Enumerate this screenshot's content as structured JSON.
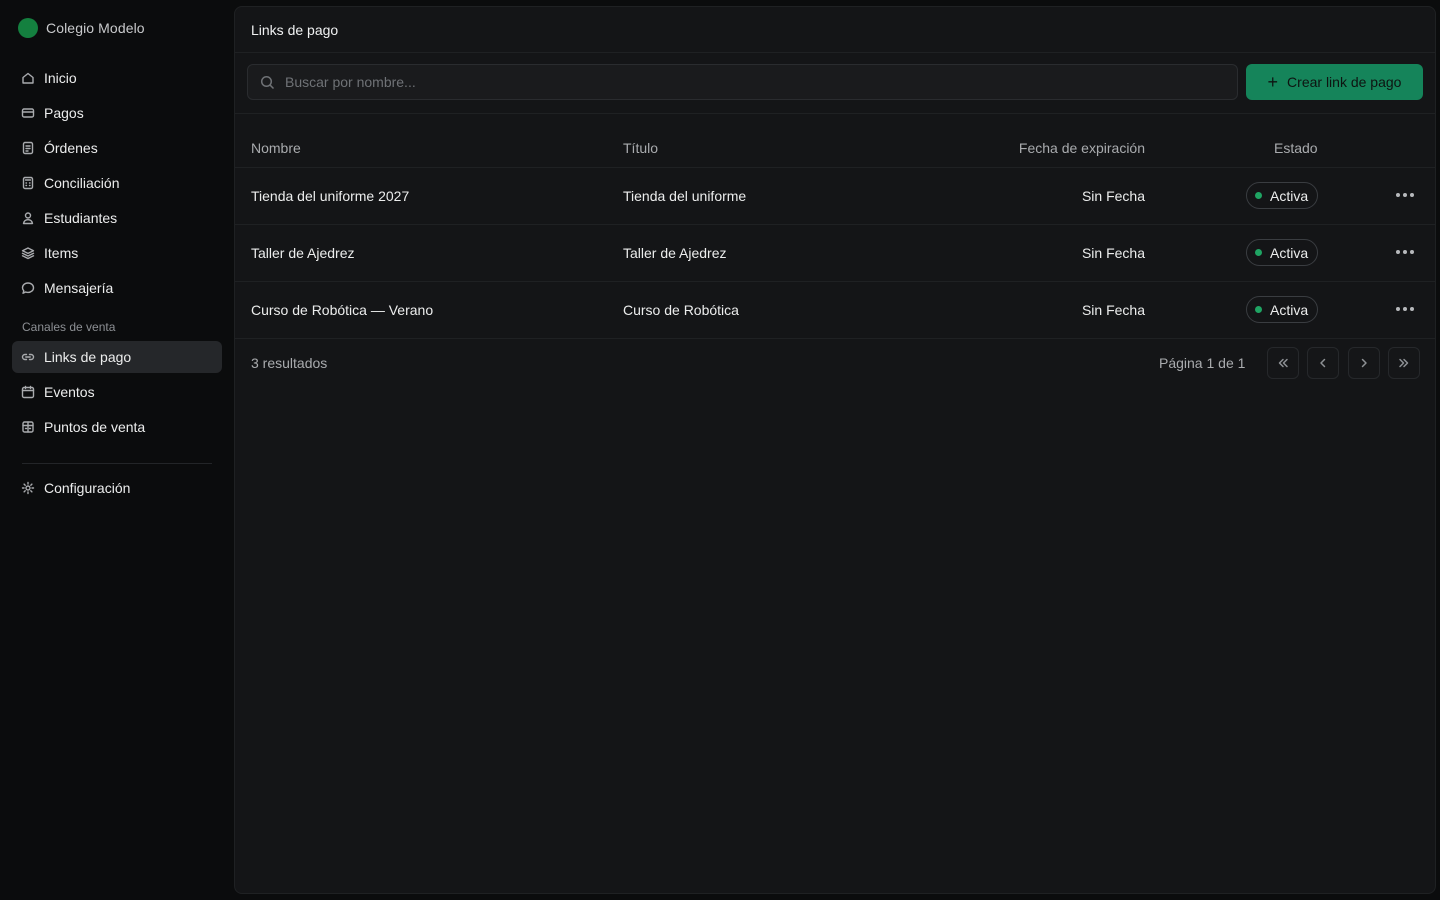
{
  "brand": {
    "name": "Colegio Modelo",
    "logo_color": "#14803f"
  },
  "sidebar": {
    "items": [
      {
        "label": "Inicio",
        "icon": "home-icon"
      },
      {
        "label": "Pagos",
        "icon": "credit-card-icon"
      },
      {
        "label": "Órdenes",
        "icon": "receipt-icon"
      },
      {
        "label": "Conciliación",
        "icon": "calculator-icon"
      },
      {
        "label": "Estudiantes",
        "icon": "user-icon"
      },
      {
        "label": "Items",
        "icon": "layers-icon"
      },
      {
        "label": "Mensajería",
        "icon": "message-icon"
      }
    ],
    "section_label": "Canales de venta",
    "channels": [
      {
        "label": "Links de pago",
        "icon": "link-icon",
        "active": true
      },
      {
        "label": "Eventos",
        "icon": "calendar-icon"
      },
      {
        "label": "Puntos de venta",
        "icon": "store-icon"
      }
    ],
    "settings": {
      "label": "Configuración",
      "icon": "gear-icon"
    }
  },
  "header": {
    "title": "Links de pago"
  },
  "search": {
    "placeholder": "Buscar por nombre..."
  },
  "toolbar": {
    "create_label": "Crear link de pago",
    "accent": "#15845a"
  },
  "table": {
    "columns": {
      "name": "Nombre",
      "title": "Título",
      "expiration": "Fecha de expiración",
      "status": "Estado"
    },
    "rows": [
      {
        "name": "Tienda del uniforme 2027",
        "title": "Tienda del uniforme",
        "expiration": "Sin Fecha",
        "status": "Activa"
      },
      {
        "name": "Taller de Ajedrez",
        "title": "Taller de Ajedrez",
        "expiration": "Sin Fecha",
        "status": "Activa"
      },
      {
        "name": "Curso de Robótica — Verano",
        "title": "Curso de Robótica",
        "expiration": "Sin Fecha",
        "status": "Activa"
      }
    ],
    "status_color": "#1fa463"
  },
  "pagination": {
    "results": "3 resultados",
    "page_info": "Página 1 de 1"
  }
}
